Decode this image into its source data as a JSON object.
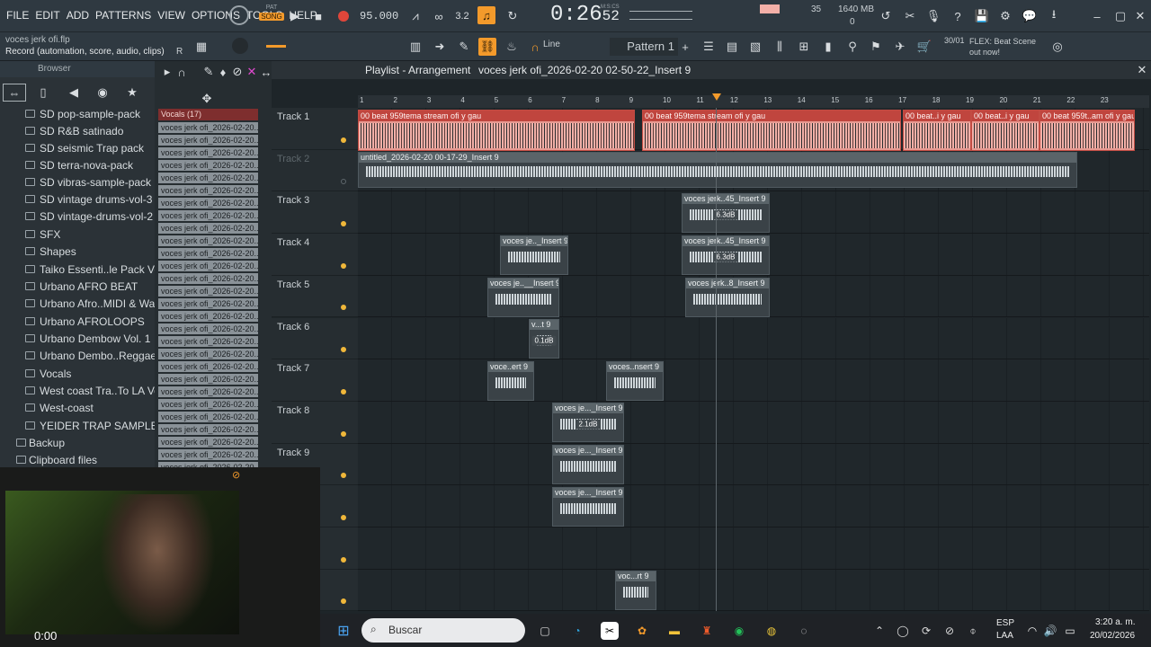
{
  "menu": [
    "FILE",
    "EDIT",
    "ADD",
    "PATTERNS",
    "VIEW",
    "OPTIONS",
    "TOOLS",
    "HELP"
  ],
  "pat_song": {
    "pat": "PAT",
    "song": "SONG"
  },
  "tempo": "95.000",
  "time_display": {
    "main": "0:26",
    "sub": "52",
    "label": "M:S:CS"
  },
  "project": {
    "file": "voces jerk ofi.flp",
    "record_hint": "Record  (automation, score, audio, clips)",
    "record_key": "R"
  },
  "cpu": {
    "value": "35",
    "memory": "1640 MB",
    "poly": "0"
  },
  "snap": "Line",
  "pattern": "Pattern 1",
  "news": {
    "count": "30/01",
    "text": "FLEX: Beat Scene out now!"
  },
  "browser": {
    "title": "Browser",
    "items": [
      "SD pop-sample-pack",
      "SD R&B satinado",
      "SD seismic Trap pack",
      "SD terra-nova-pack",
      "SD vibras-sample-pack",
      "SD vintage drums-vol-3",
      "SD vintage-drums-vol-2",
      "SFX",
      "Shapes",
      "Taiko Essenti..le Pack Vol. 1",
      "Urbano AFRO BEAT",
      "Urbano Afro..MIDI & Wave",
      "Urbano AFROLOOPS",
      "Urbano Dembow Vol. 1",
      "Urbano Dembo..Reggaeton",
      "Vocals",
      "West coast Tra..To LA Vol. 1",
      "West-coast",
      "YEIDER TRAP SAMPLES",
      "Backup",
      "Clipboard files"
    ]
  },
  "channels": {
    "header": "Vocals (17)",
    "item": "voces jerk ofi_2026-02-20..."
  },
  "playlist": {
    "title": "Playlist - Arrangement",
    "breadcrumb": "voces jerk ofi_2026-02-20 02-50-22_Insert 9",
    "ruler": [
      "1",
      "2",
      "3",
      "4",
      "5",
      "6",
      "7",
      "8",
      "9",
      "10",
      "11",
      "12",
      "13",
      "14",
      "15",
      "16",
      "17",
      "18",
      "19",
      "20",
      "21",
      "22",
      "23"
    ],
    "tracks": [
      "Track 1",
      "Track 2",
      "Track 3",
      "Track 4",
      "Track 5",
      "Track 6",
      "Track 7",
      "Track 8",
      "Track 9",
      "",
      "",
      ""
    ],
    "clips": {
      "t1a": "00 beat 959tema stream ofi y gau",
      "t1b": "00 beat 959tema stream ofi y gau",
      "t1c": "00 beat..i y gau",
      "t1d": "00 beat..i y gau",
      "t1e": "00 beat 959t..am ofi y gau",
      "t2": "untitled_2026-02-20 00-17-29_Insert 9",
      "t3": "voces jerk..45_Insert 9",
      "t4a": "voces je.._Insert 9",
      "t4b": "voces jerk..45_Insert 9",
      "t5a": "voces je..__Insert 9",
      "t5b": "voces jerk..8_Insert 9",
      "t6": "v...t 9",
      "t7a": "voce..ert 9",
      "t7b": "voces..nsert 9",
      "t8": "voces je..._Insert 9",
      "t9": "voces je..._Insert 9",
      "t10": "voces je..._Insert 9",
      "t12": "voc...rt 9"
    },
    "db": {
      "t3": "6.3dB",
      "t4b": "6.3dB",
      "t6": "0.1dB",
      "t8": "2.1dB"
    }
  },
  "webcam": {
    "time": "0:00"
  },
  "taskbar": {
    "search": "Buscar",
    "lang1": "ESP",
    "lang2": "LAA",
    "clock": "3:20 a. m.",
    "date": "20/02/2026"
  },
  "colors": {
    "accent": "#f0b73a",
    "audio_clip": "#e89a92",
    "audio_header": "#c0453e",
    "record": "#e0463a"
  }
}
